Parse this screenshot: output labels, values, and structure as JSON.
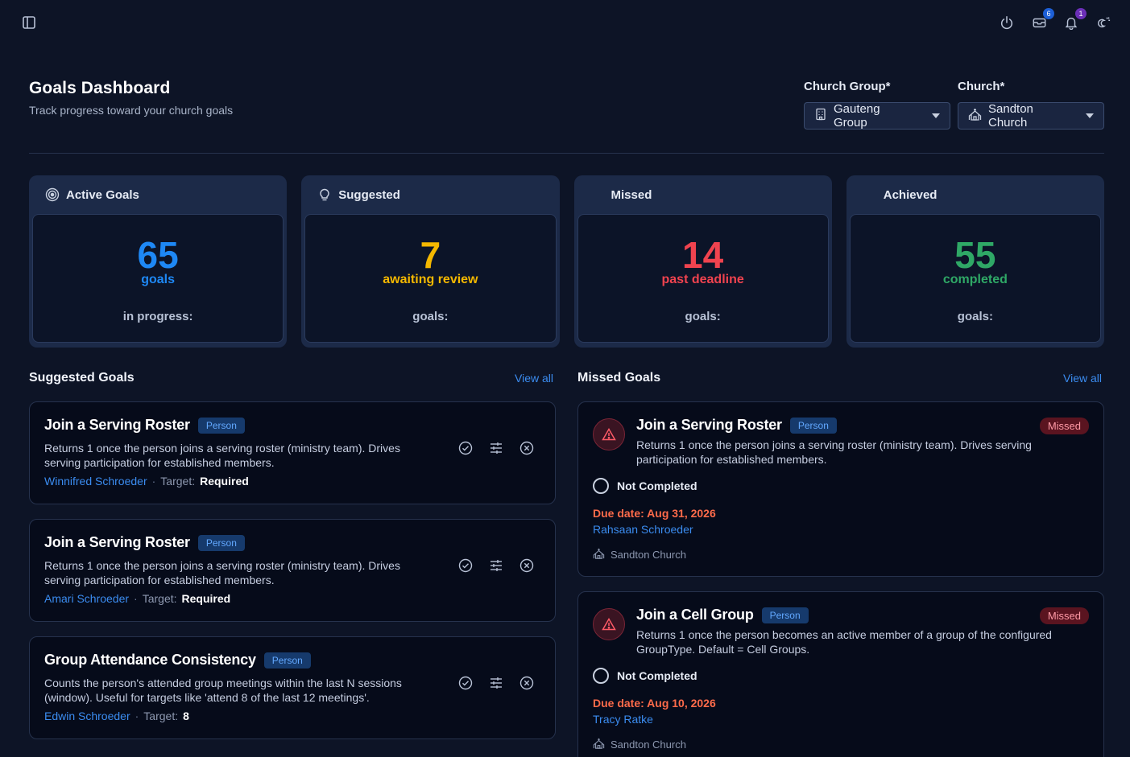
{
  "topbar": {
    "inbox_badge": "6",
    "notifications_badge": "1"
  },
  "header": {
    "title": "Goals Dashboard",
    "subtitle": "Track progress toward your church goals"
  },
  "filters": {
    "church_group_label": "Church Group*",
    "church_group_value": "Gauteng Group",
    "church_label": "Church*",
    "church_value": "Sandton Church"
  },
  "stats": [
    {
      "label": "Active Goals",
      "value": "65",
      "sub": "goals",
      "foot": "in progress:",
      "color": "#1e88f5",
      "icon": "target-icon"
    },
    {
      "label": "Suggested",
      "value": "7",
      "sub": "awaiting review",
      "foot": "goals:",
      "color": "#f5b800",
      "icon": "lightbulb-icon"
    },
    {
      "label": "Missed",
      "value": "14",
      "sub": "past deadline",
      "foot": "goals:",
      "color": "#f0434f",
      "icon": ""
    },
    {
      "label": "Achieved",
      "value": "55",
      "sub": "completed",
      "foot": "goals:",
      "color": "#2fa866",
      "icon": ""
    }
  ],
  "suggested": {
    "title": "Suggested Goals",
    "view_all": "View all",
    "items": [
      {
        "title": "Join a Serving Roster",
        "type": "Person",
        "desc": "Returns 1 once the person joins a serving roster (ministry team). Drives serving participation for established members.",
        "person": "Winnifred Schroeder",
        "target_label": "Target:",
        "target": "Required"
      },
      {
        "title": "Join a Serving Roster",
        "type": "Person",
        "desc": "Returns 1 once the person joins a serving roster (ministry team). Drives serving participation for established members.",
        "person": "Amari Schroeder",
        "target_label": "Target:",
        "target": "Required"
      },
      {
        "title": "Group Attendance Consistency",
        "type": "Person",
        "desc": "Counts the person's attended group meetings within the last N sessions (window). Useful for targets like 'attend 8 of the last 12 meetings'.",
        "person": "Edwin Schroeder",
        "target_label": "Target:",
        "target": "8"
      }
    ]
  },
  "missed": {
    "title": "Missed Goals",
    "view_all": "View all",
    "items": [
      {
        "title": "Join a Serving Roster",
        "type": "Person",
        "status_pill": "Missed",
        "desc": "Returns 1 once the person joins a serving roster (ministry team). Drives serving participation for established members.",
        "status": "Not Completed",
        "due": "Due date: Aug 31, 2026",
        "person": "Rahsaan Schroeder",
        "church": "Sandton Church"
      },
      {
        "title": "Join a Cell Group",
        "type": "Person",
        "status_pill": "Missed",
        "desc": "Returns 1 once the person becomes an active member of a group of the configured GroupType. Default = Cell Groups.",
        "status": "Not Completed",
        "due": "Due date: Aug 10, 2026",
        "person": "Tracy Ratke",
        "church": "Sandton Church"
      }
    ]
  }
}
